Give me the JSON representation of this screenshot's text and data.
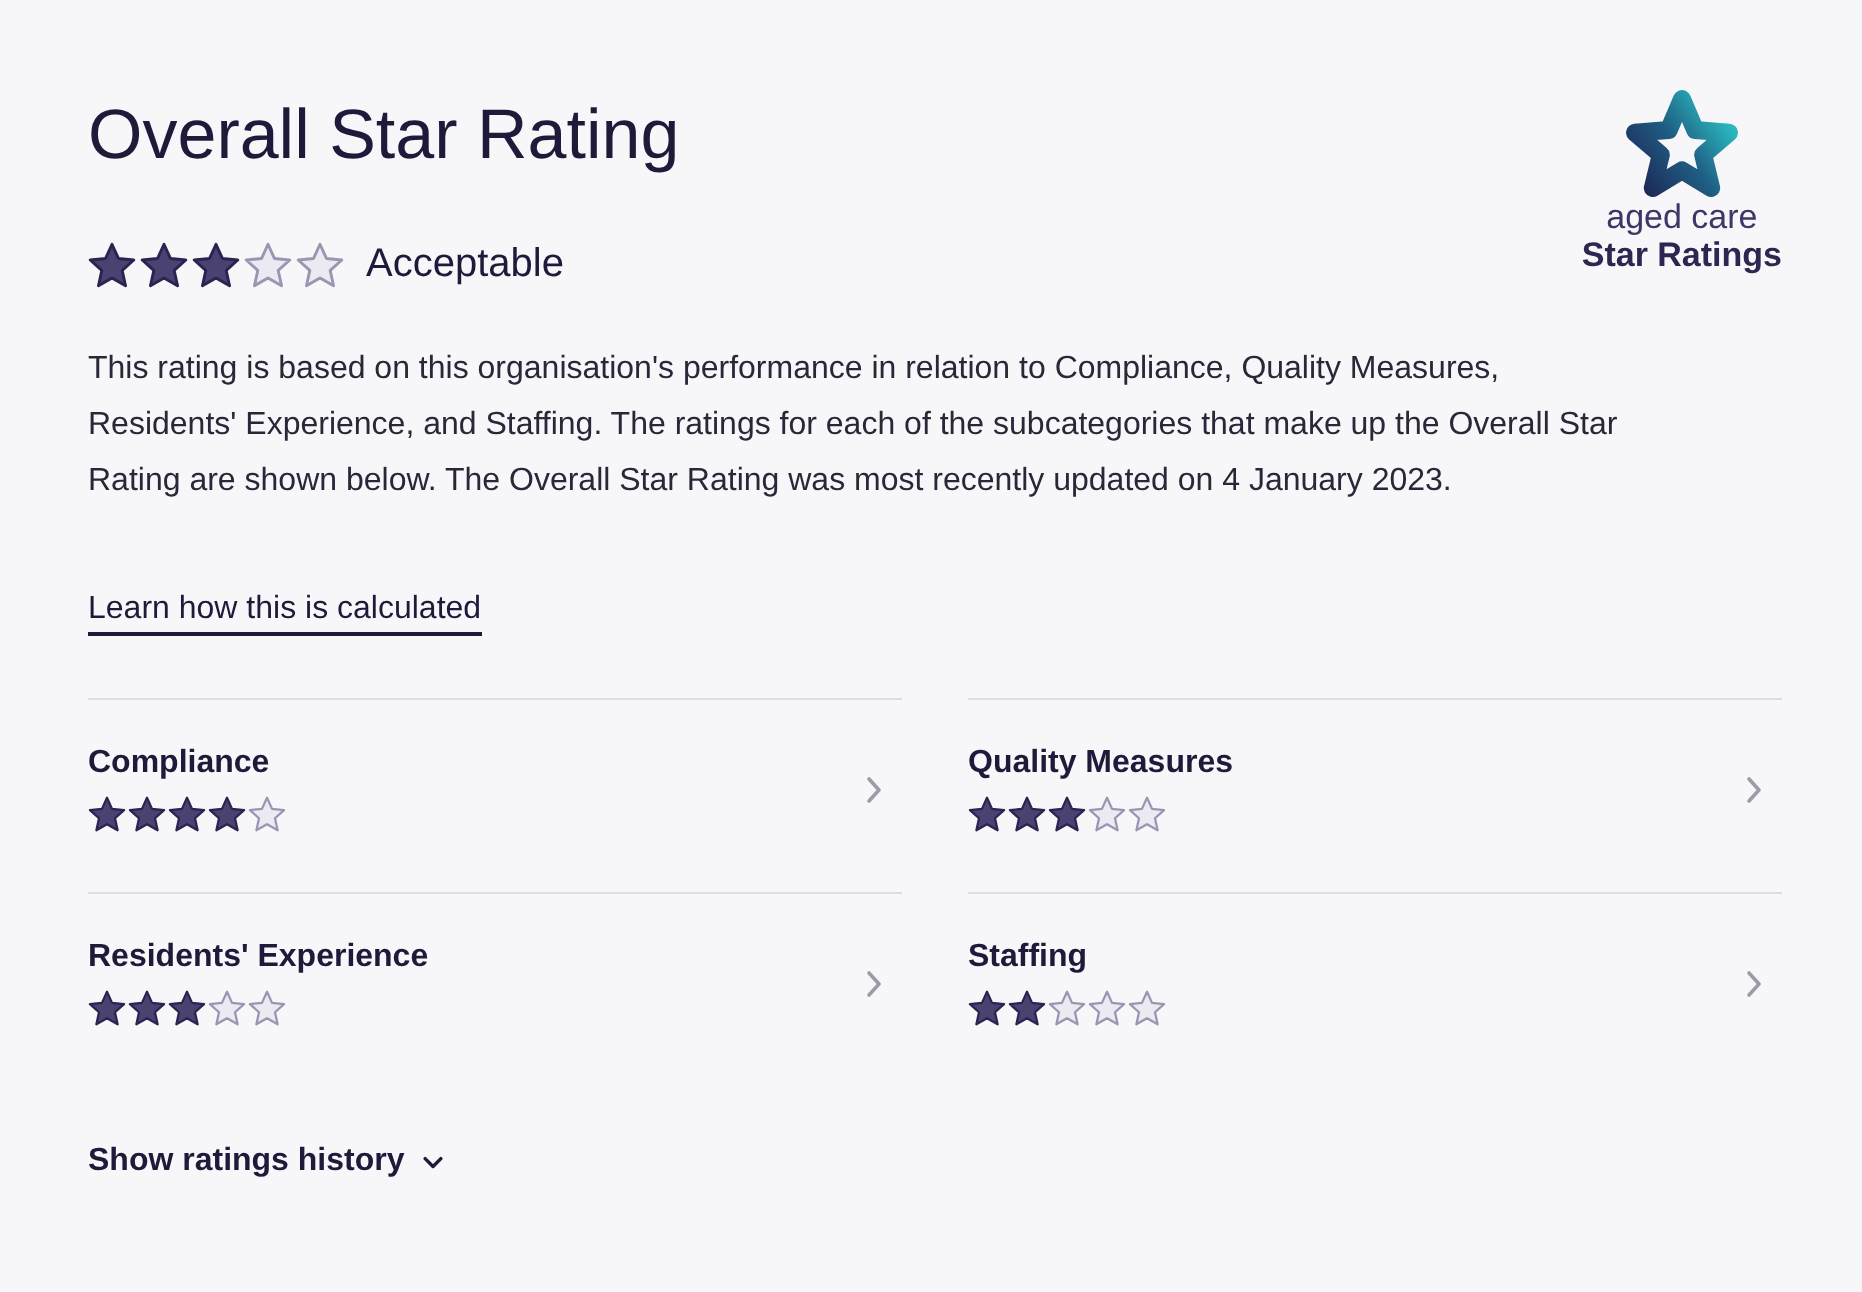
{
  "header": {
    "title": "Overall Star Rating",
    "stars": 3,
    "rating_label": "Acceptable"
  },
  "logo": {
    "line_1": "aged care",
    "line_2": "Star Ratings"
  },
  "description": "This rating is based on this organisation's performance in relation to Compliance, Quality Measures, Residents' Experience, and Staffing. The ratings for each of the subcategories that make up the Overall Star Rating are shown below. The Overall Star Rating was most recently updated on 4 January 2023.",
  "link": "Learn how this is calculated",
  "subcategories": [
    {
      "name": "Compliance",
      "stars": 4
    },
    {
      "name": "Quality Measures",
      "stars": 3
    },
    {
      "name": "Residents' Experience",
      "stars": 3
    },
    {
      "name": "Staffing",
      "stars": 2
    }
  ],
  "history_toggle": {
    "label": "Show ratings history",
    "expanded": false
  }
}
